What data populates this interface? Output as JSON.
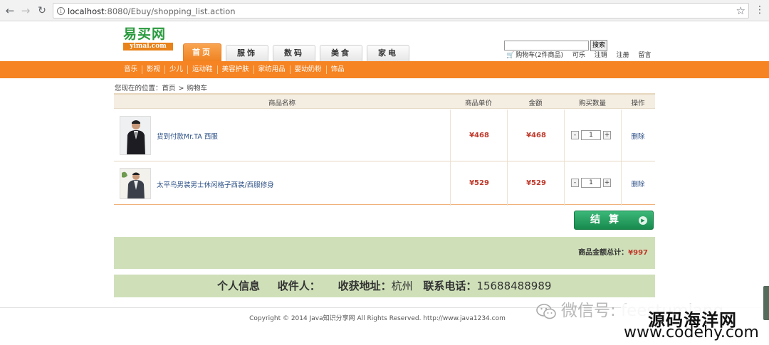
{
  "browser": {
    "url_host": "localhost",
    "url_rest": ":8080/Ebuy/shopping_list.action"
  },
  "logo": {
    "cn": "易买网",
    "en": "yimai.com"
  },
  "tabs": [
    {
      "label": "首页"
    },
    {
      "label": "服饰"
    },
    {
      "label": "数码"
    },
    {
      "label": "美食"
    },
    {
      "label": "家电"
    }
  ],
  "top_links": {
    "cart": "购物车(2件商品)",
    "user": "可乐",
    "logout": "注销",
    "register": "注册",
    "message": "留言"
  },
  "search": {
    "button": "搜索",
    "value": ""
  },
  "subnav": [
    "音乐",
    "影视",
    "少儿",
    "运动鞋",
    "美容护肤",
    "家纺用品",
    "婴幼奶粉",
    "饰品"
  ],
  "breadcrumb": {
    "prefix": "您现在的位置：",
    "home": "首页",
    "sep": ">",
    "current": "购物车"
  },
  "table": {
    "headers": {
      "name": "商品名称",
      "unit_price": "商品单价",
      "amount": "金额",
      "quantity": "购买数量",
      "action": "操作"
    },
    "rows": [
      {
        "name": "货到付款Mr.TA 西服",
        "unit_price": "¥468",
        "amount": "¥468",
        "qty": "1",
        "minus": "-",
        "plus": "+",
        "delete": "删除"
      },
      {
        "name": "太平鸟男装男士休闲格子西装/西服修身",
        "unit_price": "¥529",
        "amount": "¥529",
        "qty": "1",
        "minus": "-",
        "plus": "+",
        "delete": "删除"
      }
    ]
  },
  "checkout": {
    "label": "结算"
  },
  "total": {
    "label": "商品金额总计：",
    "amount": "¥997"
  },
  "info": {
    "personal": "个人信息",
    "receiver_label": "收件人：",
    "address_label": "收获地址：",
    "address_value": "杭州",
    "phone_label": "联系电话：",
    "phone_value": "15688488989"
  },
  "footer": {
    "text": "Copyright © 2014 Java知识分享网 All Rights Reserved. http://www.java1234.com"
  },
  "watermark": {
    "wechat": "微信号: feestumlang",
    "site_name": "源码海洋网",
    "site_url": "www.codehy.com"
  },
  "colors": {
    "orange": "#f68423",
    "green_bar": "#cfe0b9",
    "price_red": "#c0392b",
    "checkout_green": "#178a4d"
  }
}
